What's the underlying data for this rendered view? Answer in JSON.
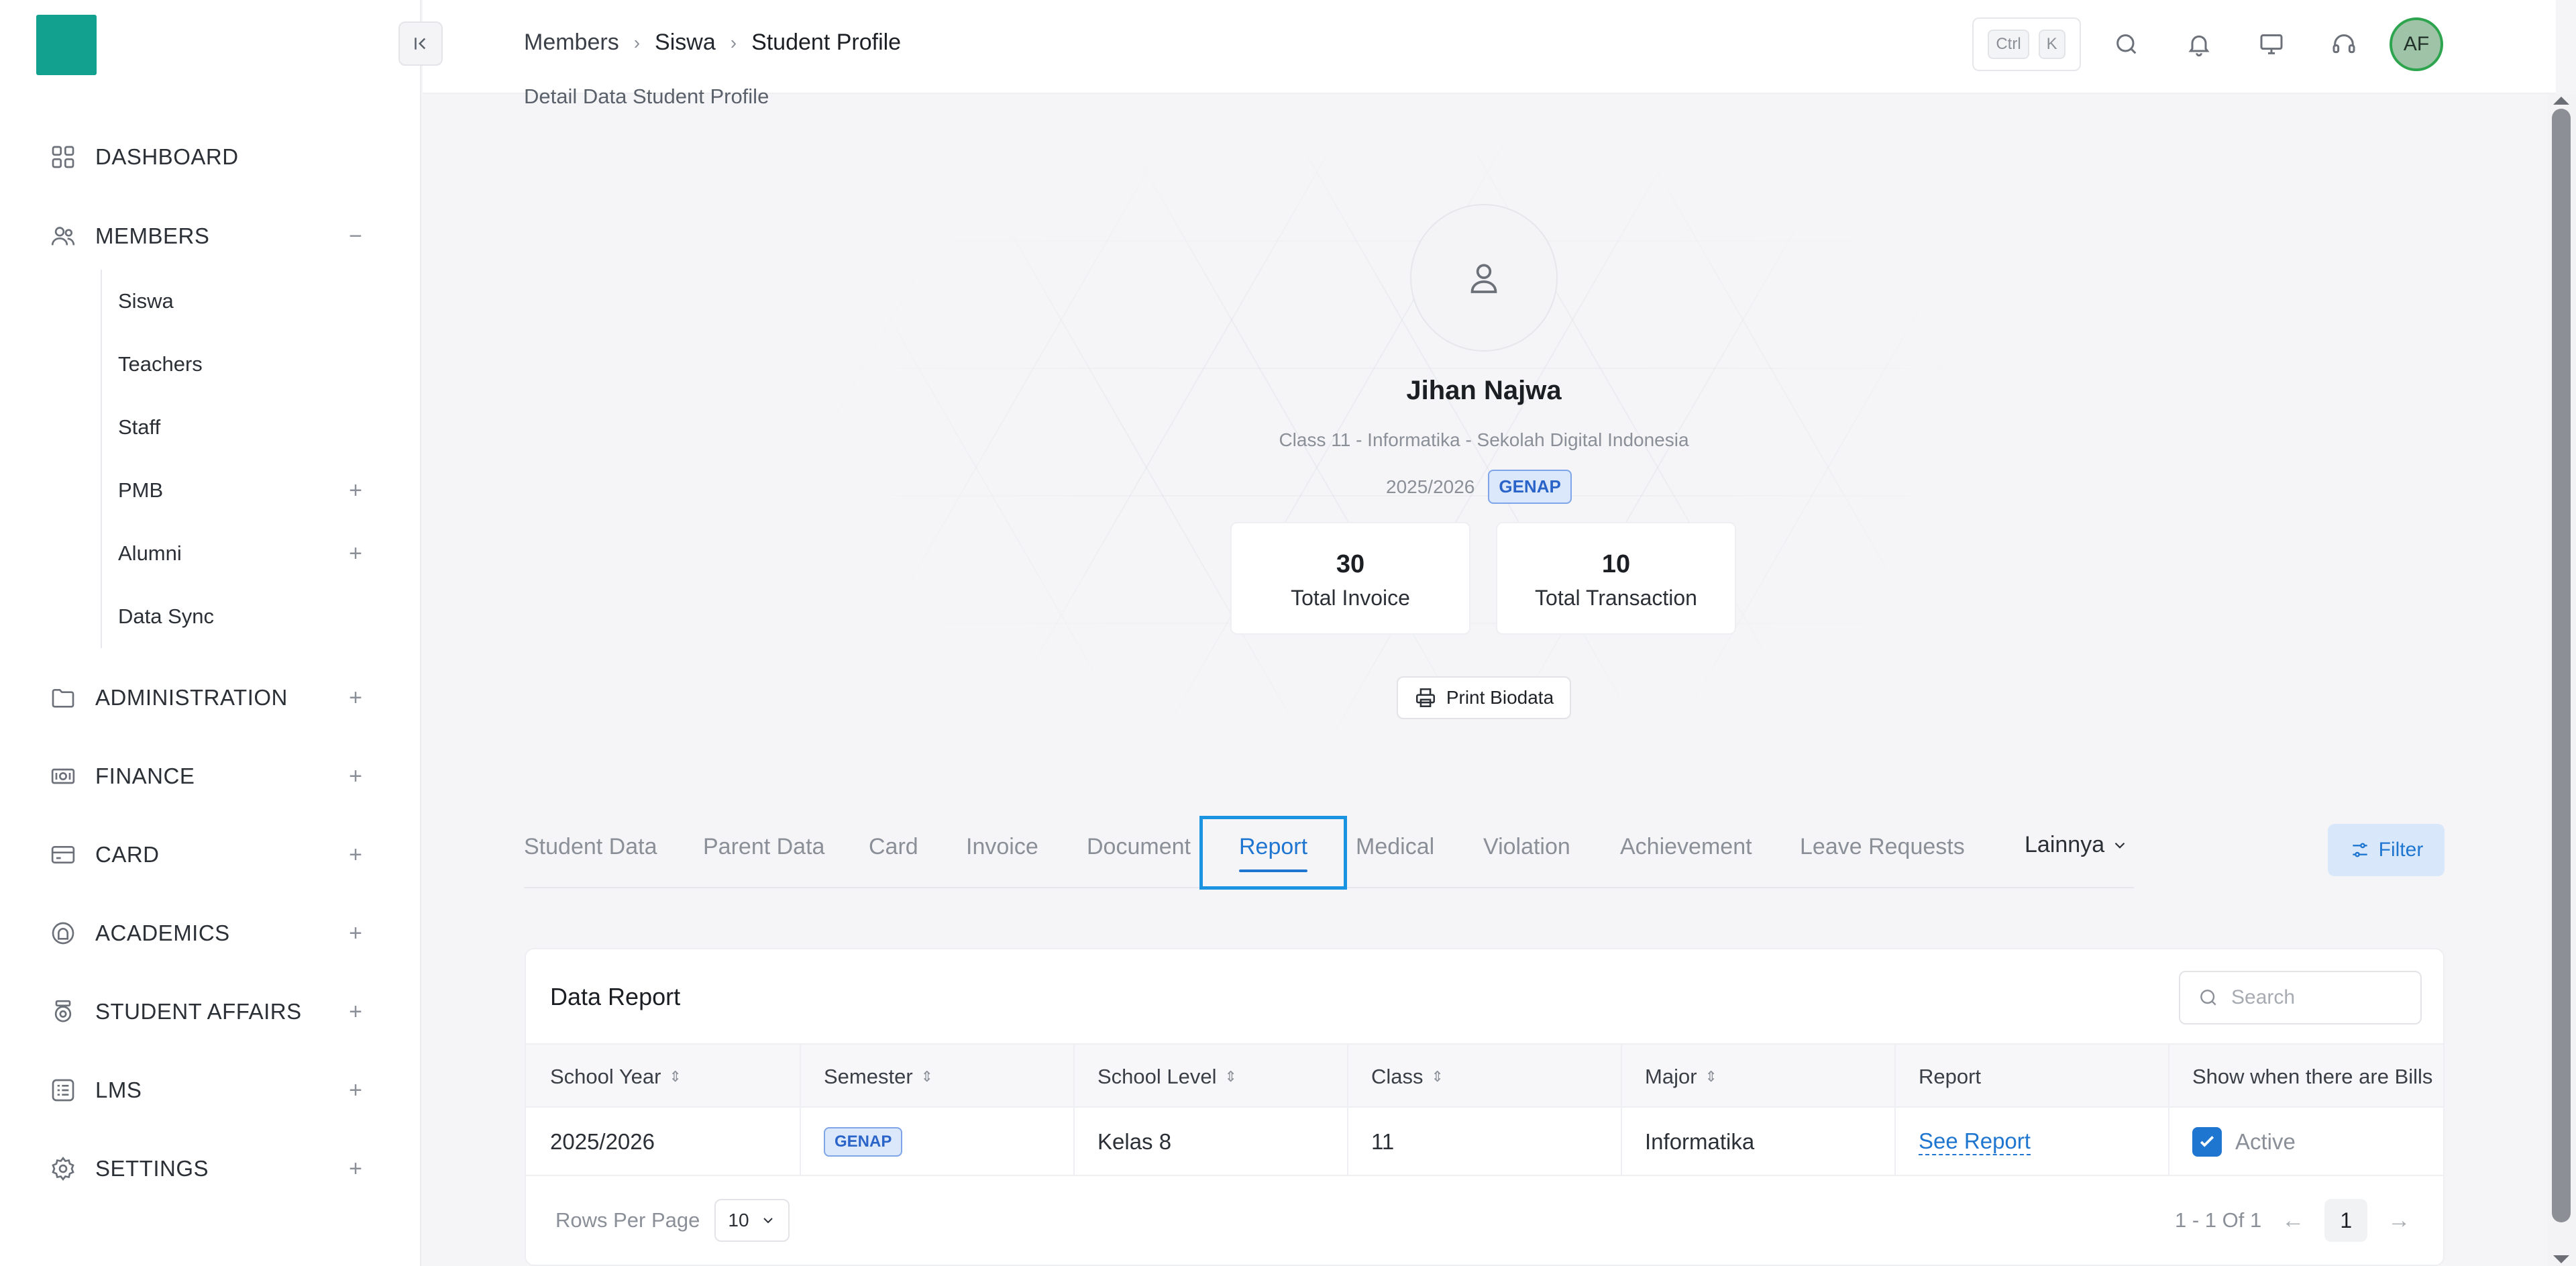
{
  "breadcrumb": {
    "root": "Members",
    "mid": "Siswa",
    "current": "Student Profile"
  },
  "header": {
    "kbd_ctrl": "Ctrl",
    "kbd_k": "K",
    "avatar_initials": "AF"
  },
  "sidebar": {
    "items": [
      {
        "label": "DASHBOARD",
        "icon": "dashboard-icon",
        "toggle": ""
      },
      {
        "label": "MEMBERS",
        "icon": "users-icon",
        "toggle": "−"
      },
      {
        "label": "ADMINISTRATION",
        "icon": "folder-icon",
        "toggle": "+"
      },
      {
        "label": "FINANCE",
        "icon": "money-icon",
        "toggle": "+"
      },
      {
        "label": "CARD",
        "icon": "card-icon",
        "toggle": "+"
      },
      {
        "label": "ACADEMICS",
        "icon": "academics-icon",
        "toggle": "+"
      },
      {
        "label": "STUDENT AFFAIRS",
        "icon": "student-affairs-icon",
        "toggle": "+"
      },
      {
        "label": "LMS",
        "icon": "lms-icon",
        "toggle": "+"
      },
      {
        "label": "SETTINGS",
        "icon": "gear-icon",
        "toggle": "+"
      }
    ],
    "members_sub": [
      {
        "label": "Siswa",
        "toggle": ""
      },
      {
        "label": "Teachers",
        "toggle": ""
      },
      {
        "label": "Staff",
        "toggle": ""
      },
      {
        "label": "PMB",
        "toggle": "+"
      },
      {
        "label": "Alumni",
        "toggle": "+"
      },
      {
        "label": "Data Sync",
        "toggle": ""
      }
    ]
  },
  "page": {
    "subtitle": "Detail Data Student Profile"
  },
  "profile": {
    "name": "Jihan Najwa",
    "info": "Class 11 - Informatika - Sekolah Digital Indonesia",
    "year": "2025/2026",
    "semester": "GENAP",
    "stats": [
      {
        "value": "30",
        "label": "Total Invoice"
      },
      {
        "value": "10",
        "label": "Total Transaction"
      }
    ],
    "print_label": "Print Biodata"
  },
  "tabs": {
    "items": [
      "Student Data",
      "Parent Data",
      "Card",
      "Invoice",
      "Document",
      "Report",
      "Medical",
      "Violation",
      "Achievement",
      "Leave Requests"
    ],
    "active": "Report",
    "more": "Lainnya",
    "filter": "Filter"
  },
  "table": {
    "title": "Data Report",
    "search_placeholder": "Search",
    "headers": [
      "School Year",
      "Semester",
      "School Level",
      "Class",
      "Major",
      "Report",
      "Show when there are Bills"
    ],
    "row": {
      "school_year": "2025/2026",
      "semester": "GENAP",
      "school_level": "Kelas 8",
      "class": "11",
      "major": "Informatika",
      "report": "See Report",
      "status": "Active"
    },
    "rows_per_page_label": "Rows Per Page",
    "rows_per_page": "10",
    "pagination_info": "1 - 1 Of 1",
    "page": "1"
  },
  "colors": {
    "accent": "#1f76d1",
    "brand": "#12a08f"
  }
}
